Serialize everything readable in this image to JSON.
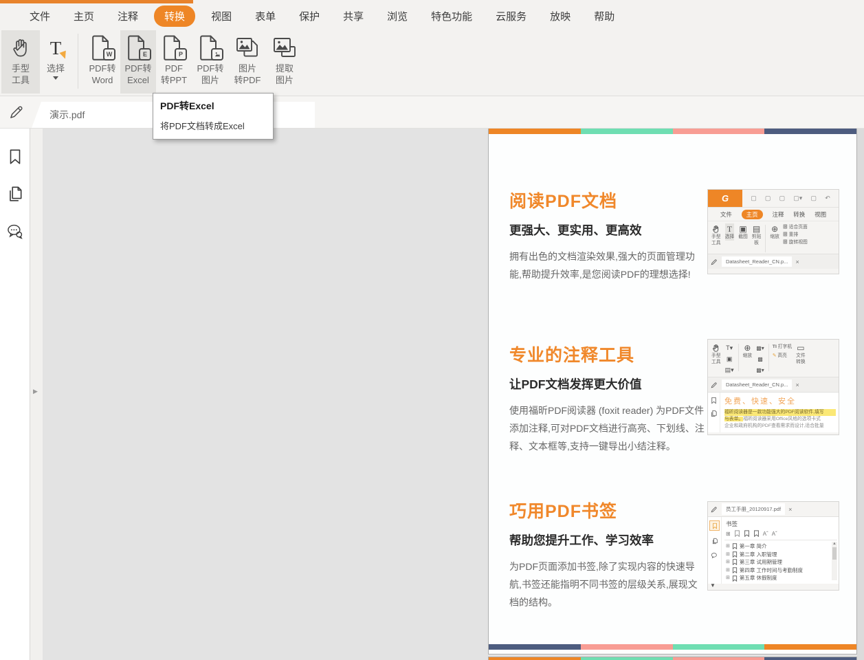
{
  "colors": {
    "accent": "#EE8626",
    "ribbon_bg": "#F3F2F0",
    "canvas_bg": "#E3E3E3",
    "strip": [
      "#EE8626",
      "#6FDEB2",
      "#F89D94",
      "#4D5C7F"
    ],
    "section_title": "#F0882B",
    "highlight": "#FBE876"
  },
  "menu": {
    "active": "转换",
    "items": [
      "文件",
      "主页",
      "注释",
      "转换",
      "视图",
      "表单",
      "保护",
      "共享",
      "浏览",
      "特色功能",
      "云服务",
      "放映",
      "帮助"
    ]
  },
  "ribbon": {
    "buttons": [
      {
        "line1": "手型",
        "line2": "工具",
        "state": "selected"
      },
      {
        "line1": "选择",
        "line2": ""
      },
      {
        "line1": "PDF转",
        "line2": "Word",
        "badge": "W"
      },
      {
        "line1": "PDF转",
        "line2": "Excel",
        "badge": "E",
        "state": "hover"
      },
      {
        "line1": "PDF",
        "line2": "转PPT",
        "badge": "P"
      },
      {
        "line1": "PDF转",
        "line2": "图片"
      },
      {
        "line1": "图片",
        "line2": "转PDF"
      },
      {
        "line1": "提取",
        "line2": "图片"
      }
    ]
  },
  "tooltip": {
    "title": "PDF转Excel",
    "desc": "将PDF文档转成Excel"
  },
  "tabbar": {
    "active_tab": "演示.pdf"
  },
  "sidebar": {
    "icons": [
      "bookmark",
      "pages",
      "comments"
    ]
  },
  "document": {
    "sections": [
      {
        "title": "阅读PDF文档",
        "subtitle": "更强大、更实用、更高效",
        "body": "拥有出色的文档渲染效果,强大的页面管理功能,帮助提升效率,是您阅读PDF的理想选择!"
      },
      {
        "title": "专业的注释工具",
        "subtitle": "让PDF文档发挥更大价值",
        "body": "使用福昕PDF阅读器 (foxit reader) 为PDF文件添加注释,可对PDF文档进行高亮、下划线、注释、文本框等,支持一键导出小结注释。"
      },
      {
        "title": "巧用PDF书签",
        "subtitle": "帮助您提升工作、学习效率",
        "body": "为PDF页面添加书签,除了实现内容的快速导航,书签还能指明不同书签的层级关系,展现文档的结构。"
      }
    ]
  },
  "mini_reader": {
    "logo": "G",
    "menu": [
      "文件",
      "主页",
      "注释",
      "转换",
      "视图"
    ],
    "menu_active": "主页",
    "tools": [
      {
        "label": "手型\n工具"
      },
      {
        "label": "选择"
      },
      {
        "label": "截图"
      },
      {
        "label": "剪贴\n板"
      },
      {
        "label": "缩放"
      }
    ],
    "view_opts": [
      "适合页面",
      "重排",
      "旋转视图"
    ],
    "tab": "Datasheet_Reader_CN.p...",
    "close": "×"
  },
  "mini_annotate": {
    "tools": [
      {
        "label": "手型\n工具"
      },
      {
        "label": "缩放"
      },
      {
        "label": "打字机",
        "prefix": "TI"
      },
      {
        "label": "高亮"
      },
      {
        "label": "文件\n转换"
      }
    ],
    "tab": "Datasheet_Reader_CN.p...",
    "close": "×",
    "doc_title": "免费、快速、安全",
    "line1": "福昕阅读器是一款功能强大的PDF阅读软件,填写",
    "line2_hl": "与表单。",
    "line2_rest": "福昕阅读器采用Office风格的选项卡式",
    "line3": "企业和政府机构的PDF查看需求而设计,适合批量"
  },
  "mini_bookmarks": {
    "tab": "员工手册_20120917.pdf",
    "close": "×",
    "panel_title": "书签",
    "items": [
      "第一章 简介",
      "第二章 入职管理",
      "第三章 试用期管理",
      "第四章 工作时间与考勤制度",
      "第五章 休假制度"
    ]
  }
}
